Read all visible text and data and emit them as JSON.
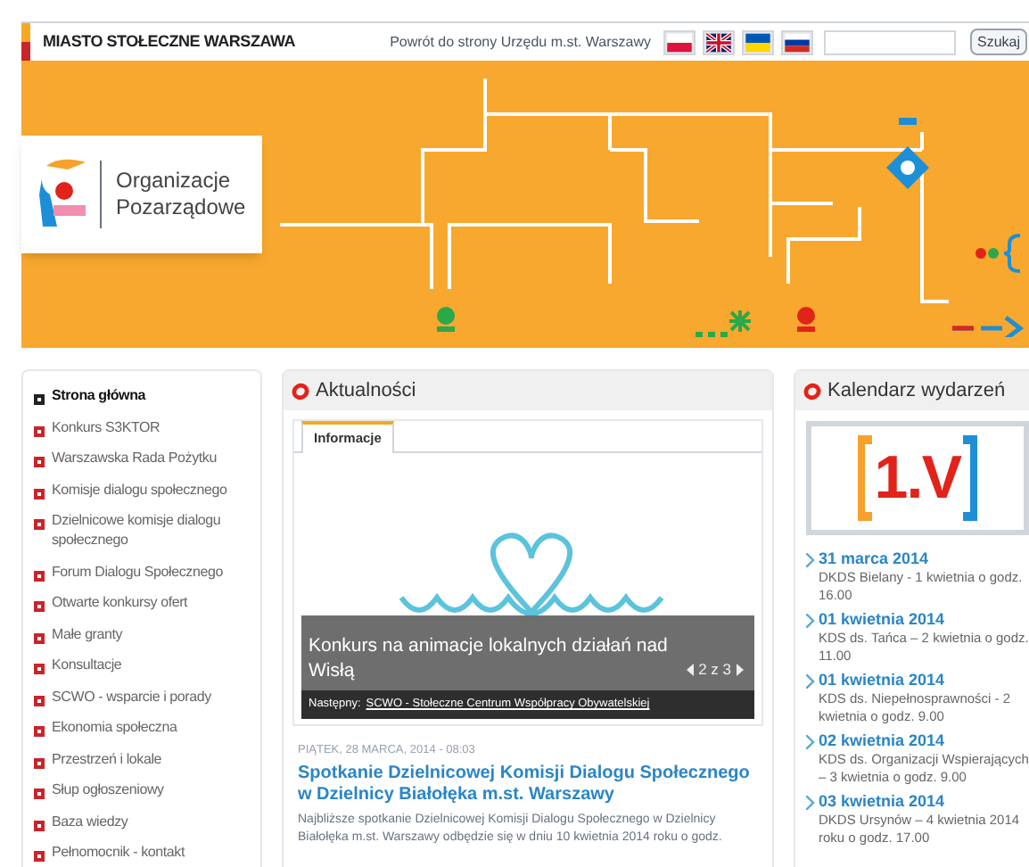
{
  "header": {
    "site_name": "MIASTO STOŁECZNE WARSZAWA",
    "back_link": "Powrót do strony Urzędu m.st. Warszawy",
    "search": {
      "button": "Szukaj"
    }
  },
  "banner": {
    "logo_text": [
      "Organizacje",
      "Pozarządowe"
    ]
  },
  "sidebar": {
    "items": [
      {
        "label": "Strona główna",
        "selected": true
      },
      {
        "label": "Konkurs S3KTOR",
        "selected": false
      },
      {
        "label": "Warszawska Rada Pożytku",
        "selected": false
      },
      {
        "label": "Komisje dialogu społecznego",
        "selected": false
      },
      {
        "label": "Dzielnicowe komisje dialogu społecznego",
        "selected": false
      },
      {
        "label": "Forum Dialogu Społecznego",
        "selected": false
      },
      {
        "label": "Otwarte konkursy ofert",
        "selected": false
      },
      {
        "label": "Małe granty",
        "selected": false
      },
      {
        "label": "Konsultacje",
        "selected": false
      },
      {
        "label": "SCWO - wsparcie i porady",
        "selected": false
      },
      {
        "label": "Ekonomia społeczna",
        "selected": false
      },
      {
        "label": "Przestrzeń i lokale",
        "selected": false
      },
      {
        "label": "Słup ogłoszeniowy",
        "selected": false
      },
      {
        "label": "Baza wiedzy",
        "selected": false
      },
      {
        "label": "Pełnomocnik - kontakt",
        "selected": false
      }
    ]
  },
  "news": {
    "title": "Aktualności",
    "tabs": [
      {
        "label": "Informacje",
        "selected": true
      }
    ],
    "slider": {
      "caption": "Konkurs na animacje lokalnych działań nad Wisłą",
      "counter": "2 z 3",
      "next_label": "Następny:",
      "next_link": "SCWO - Stołeczne Centrum Współpracy Obywatelskiej"
    },
    "article": {
      "date": "PIĄTEK, 28 MARCA, 2014 - 08:03",
      "title": "Spotkanie Dzielnicowej Komisji Dialogu Społecznego w Dzielnicy Białołęka m.st. Warszawy",
      "body": "Najbliższe spotkanie Dzielnicowej Komisji Dialogu Społecznego w Dzielnicy Białołęka m.st. Warszawy odbędzie się w dniu 10 kwietnia 2014 roku o godz."
    }
  },
  "calendar": {
    "title": "Kalendarz wydarzeń",
    "promo": "1.V",
    "events": [
      {
        "date": "31 marca 2014",
        "text": "DKDS Bielany - 1 kwietnia o godz. 16.00"
      },
      {
        "date": "01 kwietnia 2014",
        "text": "KDS ds. Tańca – 2 kwietnia o godz. 11.00"
      },
      {
        "date": "01 kwietnia 2014",
        "text": "KDS ds. Niepełnosprawności - 2 kwietnia o godz. 9.00"
      },
      {
        "date": "02 kwietnia 2014",
        "text": "KDS ds. Organizacji Wspierających – 3 kwietnia o godz. 9.00"
      },
      {
        "date": "03 kwietnia 2014",
        "text": "DKDS Ursynów – 4 kwietnia 2014 roku o godz. 17.00"
      }
    ]
  }
}
